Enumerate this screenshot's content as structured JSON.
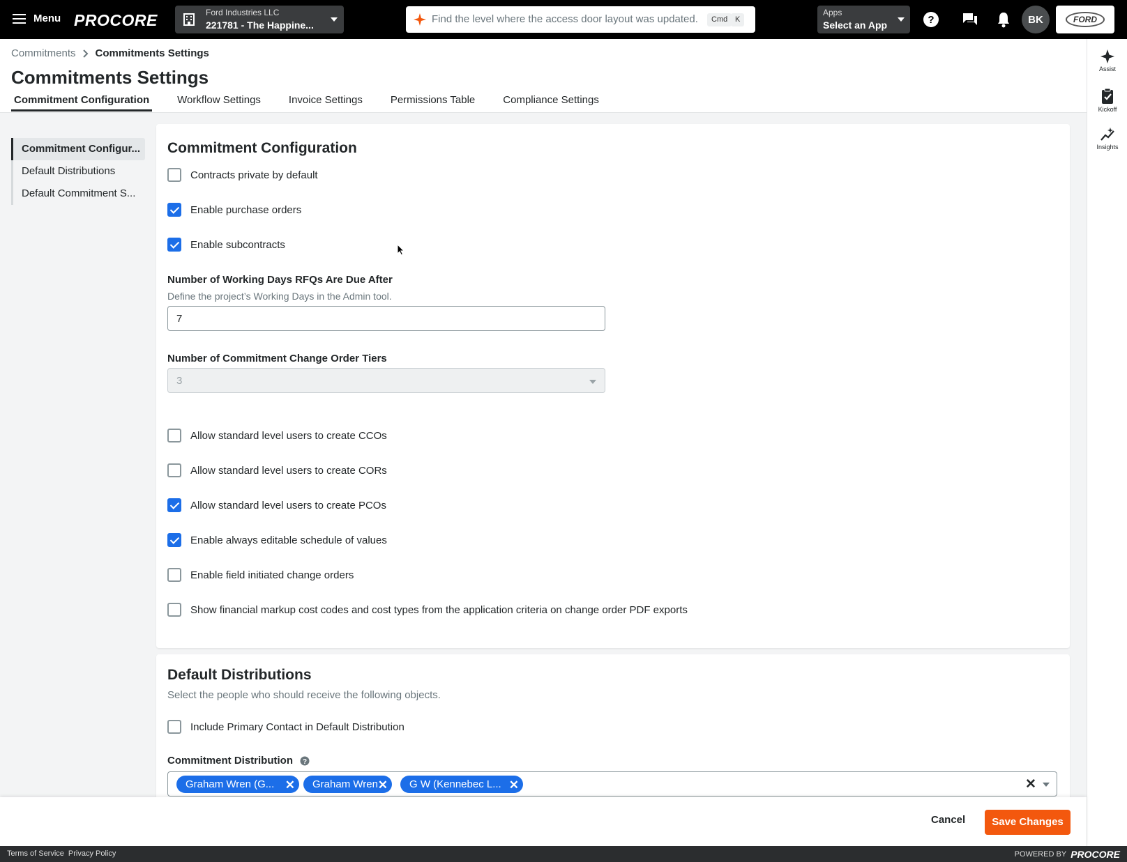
{
  "topbar": {
    "menu_label": "Menu",
    "logo": "PROCORE",
    "company": "Ford Industries LLC",
    "project": "221781 - The Happine...",
    "search_placeholder": "Find the level where the access door layout was updated.",
    "kbd1": "Cmd",
    "kbd2": "K",
    "apps_label": "Apps",
    "apps_value": "Select an App",
    "avatar": "BK",
    "company_logo": "FORD"
  },
  "rail": {
    "assist": "Assist",
    "kickoff": "Kickoff",
    "insights": "Insights"
  },
  "breadcrumb": {
    "parent": "Commitments",
    "current": "Commitments Settings"
  },
  "page_title": "Commitments Settings",
  "tabs": [
    "Commitment Configuration",
    "Workflow Settings",
    "Invoice Settings",
    "Permissions Table",
    "Compliance Settings"
  ],
  "sidenav": [
    "Commitment Configur...",
    "Default Distributions",
    "Default Commitment S..."
  ],
  "config": {
    "title": "Commitment Configuration",
    "checks": [
      {
        "label": "Contracts private by default",
        "checked": false
      },
      {
        "label": "Enable purchase orders",
        "checked": true
      },
      {
        "label": "Enable subcontracts",
        "checked": true
      }
    ],
    "rfq_label": "Number of Working Days RFQs Are Due After",
    "rfq_help": "Define the project’s Working Days in the Admin tool.",
    "rfq_value": "7",
    "tiers_label": "Number of Commitment Change Order Tiers",
    "tiers_value": "3",
    "checks2": [
      {
        "label": "Allow standard level users to create CCOs",
        "checked": false
      },
      {
        "label": "Allow standard level users to create CORs",
        "checked": false
      },
      {
        "label": "Allow standard level users to create PCOs",
        "checked": true
      },
      {
        "label": "Enable always editable schedule of values",
        "checked": true
      },
      {
        "label": "Enable field initiated change orders",
        "checked": false
      },
      {
        "label": "Show financial markup cost codes and cost types from the application criteria on change order PDF exports",
        "checked": false
      }
    ]
  },
  "distributions": {
    "title": "Default Distributions",
    "help": "Select the people who should receive the following objects.",
    "primary_contact": {
      "label": "Include Primary Contact in Default Distribution",
      "checked": false
    },
    "commitment_label": "Commitment Distribution",
    "chips": [
      "Graham Wren (G...",
      "Graham Wren",
      "G W (Kennebec L..."
    ]
  },
  "actions": {
    "cancel": "Cancel",
    "save": "Save Changes"
  },
  "footer": {
    "terms": "Terms of Service",
    "privacy": "Privacy Policy",
    "powered": "POWERED BY",
    "brand": "PROCORE"
  },
  "colors": {
    "accent": "#1c6ee8",
    "save": "#f3580e",
    "topbar": "#000000"
  }
}
